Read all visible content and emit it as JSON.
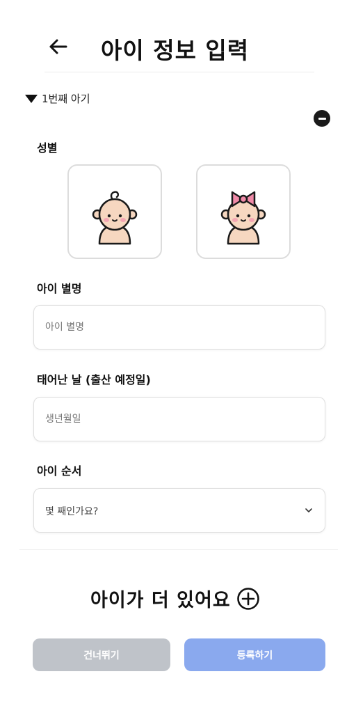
{
  "header": {
    "title": "아이 정보 입력",
    "back_icon": "arrow-left-icon"
  },
  "child_section": {
    "toggle_label": "1번째 아기",
    "remove_icon": "minus-circle-icon",
    "gender": {
      "label": "성별",
      "options": [
        {
          "name": "boy",
          "icon": "baby-boy-icon"
        },
        {
          "name": "girl",
          "icon": "baby-girl-icon"
        }
      ]
    },
    "nickname": {
      "label": "아이 별명",
      "placeholder": "아이 별명",
      "value": ""
    },
    "birthdate": {
      "label": "태어난 날 (출산 예정일)",
      "placeholder": "생년월일",
      "value": ""
    },
    "order": {
      "label": "아이 순서",
      "selected": "몇 째인가요?"
    }
  },
  "add_more": {
    "label": "아이가 더 있어요",
    "icon": "plus-circle-icon"
  },
  "actions": {
    "skip_label": "건너뛰기",
    "register_label": "등록하기"
  },
  "colors": {
    "skip_bg": "#bfc3c9",
    "register_bg": "#8aa9ee",
    "baby_skin": "#f6d7c0",
    "baby_cheek": "#f4a6b3",
    "bow": "#f08aa8"
  }
}
